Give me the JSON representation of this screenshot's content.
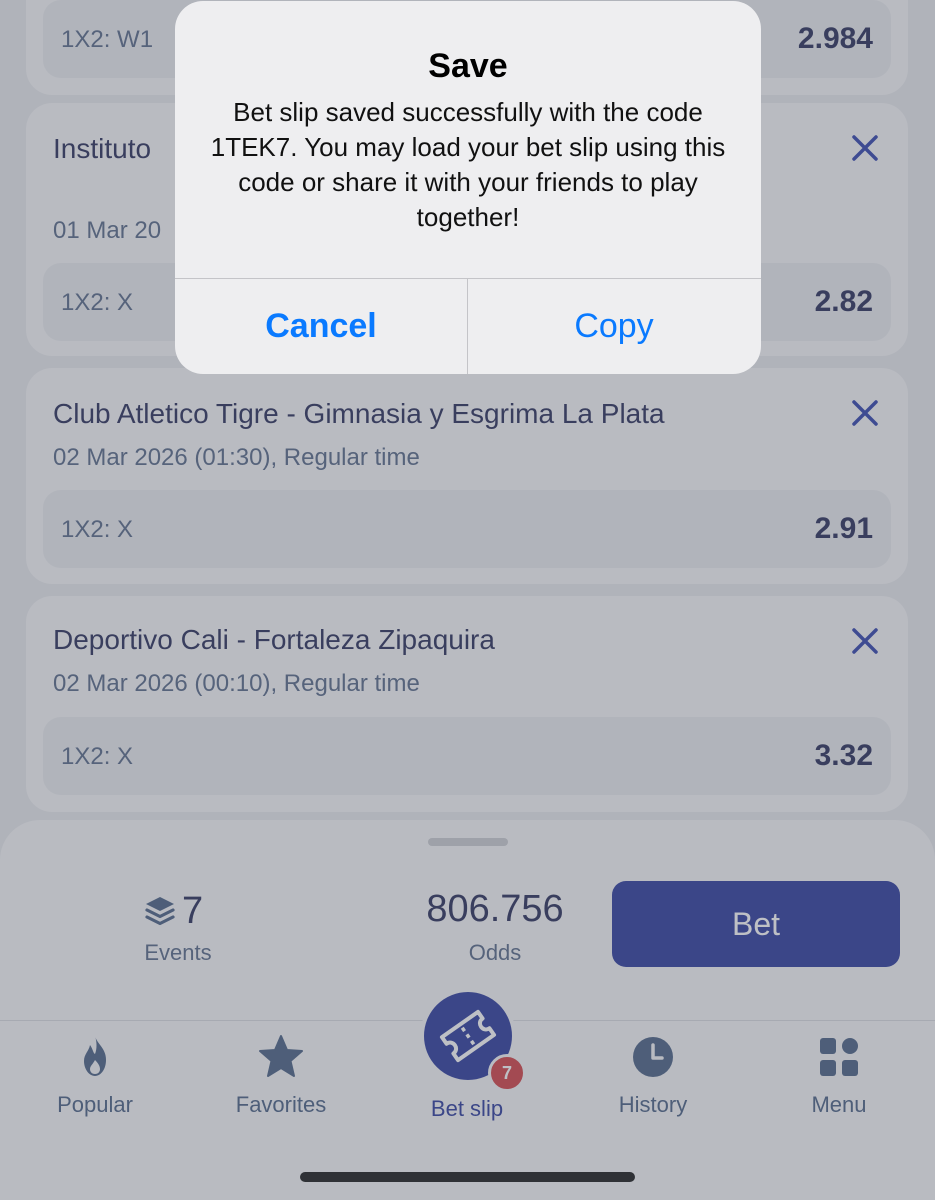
{
  "selections": [
    {
      "title": "",
      "subtitle": "",
      "market": "1X2: W1",
      "odd": "2.984"
    },
    {
      "title": "Instituto                                                ta Fe",
      "subtitle": "01 Mar 20",
      "market": "1X2: X",
      "odd": "2.82"
    },
    {
      "title": "Club Atletico Tigre - Gimnasia y Esgrima La Plata",
      "subtitle": "02 Mar 2026 (01:30), Regular time",
      "market": "1X2: X",
      "odd": "2.91"
    },
    {
      "title": "Deportivo Cali - Fortaleza Zipaquira",
      "subtitle": "02 Mar 2026 (00:10), Regular time",
      "market": "1X2: X",
      "odd": "3.32"
    }
  ],
  "summary": {
    "events_count": "7",
    "events_label": "Events",
    "odds_value": "806.756",
    "odds_label": "Odds",
    "bet_label": "Bet"
  },
  "tabbar": {
    "popular": "Popular",
    "favorites": "Favorites",
    "betslip": "Bet slip",
    "betslip_badge": "7",
    "history": "History",
    "menu": "Menu"
  },
  "dialog": {
    "title": "Save",
    "message": "Bet slip saved successfully with the code 1TEK7. You may load your bet slip using this code or share it with your friends to play together!",
    "cancel": "Cancel",
    "copy": "Copy"
  },
  "colors": {
    "accent": "#1e2e96",
    "link": "#0a7aff",
    "badge": "#d0343a"
  }
}
